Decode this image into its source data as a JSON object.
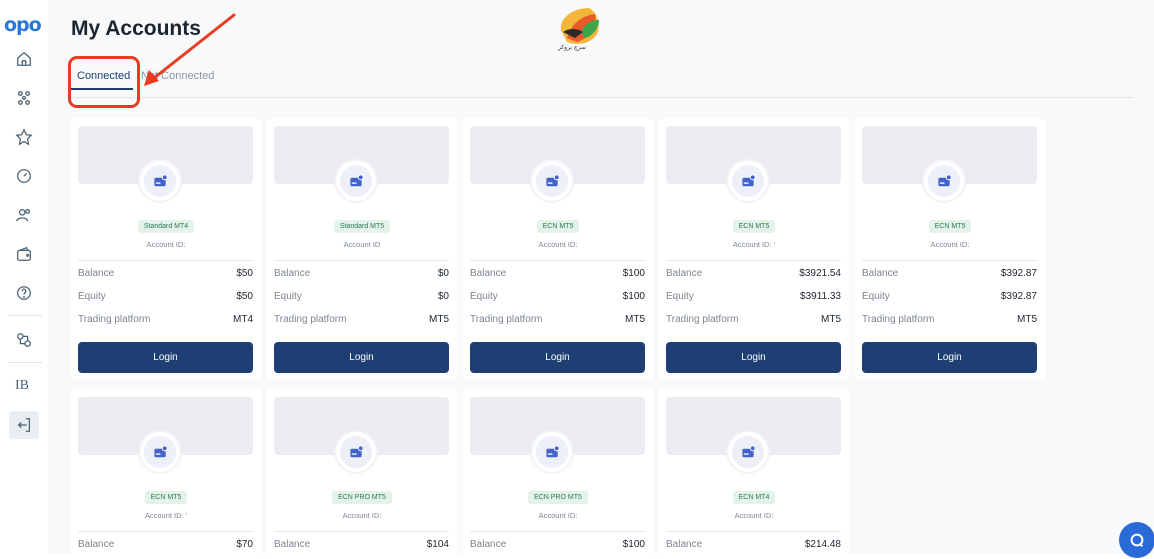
{
  "app": {
    "logo": "opo"
  },
  "sidebar": {
    "ib_label": "IB"
  },
  "page": {
    "title": "My Accounts"
  },
  "tabs": [
    {
      "label": "Connected",
      "active": true
    },
    {
      "label": "Not Connected",
      "active": false
    }
  ],
  "watermark": {
    "text": "سرچ بروکر"
  },
  "labels": {
    "account_id": "Account ID:",
    "balance": "Balance",
    "equity": "Equity",
    "platform": "Trading platform",
    "login": "Login"
  },
  "cards": [
    {
      "type": "Standard MT4",
      "account_id": "Account ID:",
      "balance": "$50",
      "equity": "$50",
      "platform": "MT4"
    },
    {
      "type": "Standard MT5",
      "account_id": "Account ID",
      "balance": "$0",
      "equity": "$0",
      "platform": "MT5"
    },
    {
      "type": "ECN MT5",
      "account_id": "Account ID:",
      "balance": "$100",
      "equity": "$100",
      "platform": "MT5"
    },
    {
      "type": "ECN MT5",
      "account_id": "Account ID: '",
      "balance": "$3921.54",
      "equity": "$3911.33",
      "platform": "MT5"
    },
    {
      "type": "ECN MT5",
      "account_id": "Account ID:",
      "balance": "$392.87",
      "equity": "$392.87",
      "platform": "MT5"
    },
    {
      "type": "ECN MT5",
      "account_id": "Account ID: '",
      "balance": "$70"
    },
    {
      "type": "ECN PRO MT5",
      "account_id": "Account ID:",
      "balance": "$104"
    },
    {
      "type": "ECN PRO MT5",
      "account_id": "Account ID:",
      "balance": "$100"
    },
    {
      "type": "ECN MT4",
      "account_id": "Account ID:",
      "balance": "$214.48"
    }
  ],
  "colors": {
    "primary": "#1e3f73",
    "accent": "#2a79d6",
    "annotation": "#ea3a22"
  }
}
